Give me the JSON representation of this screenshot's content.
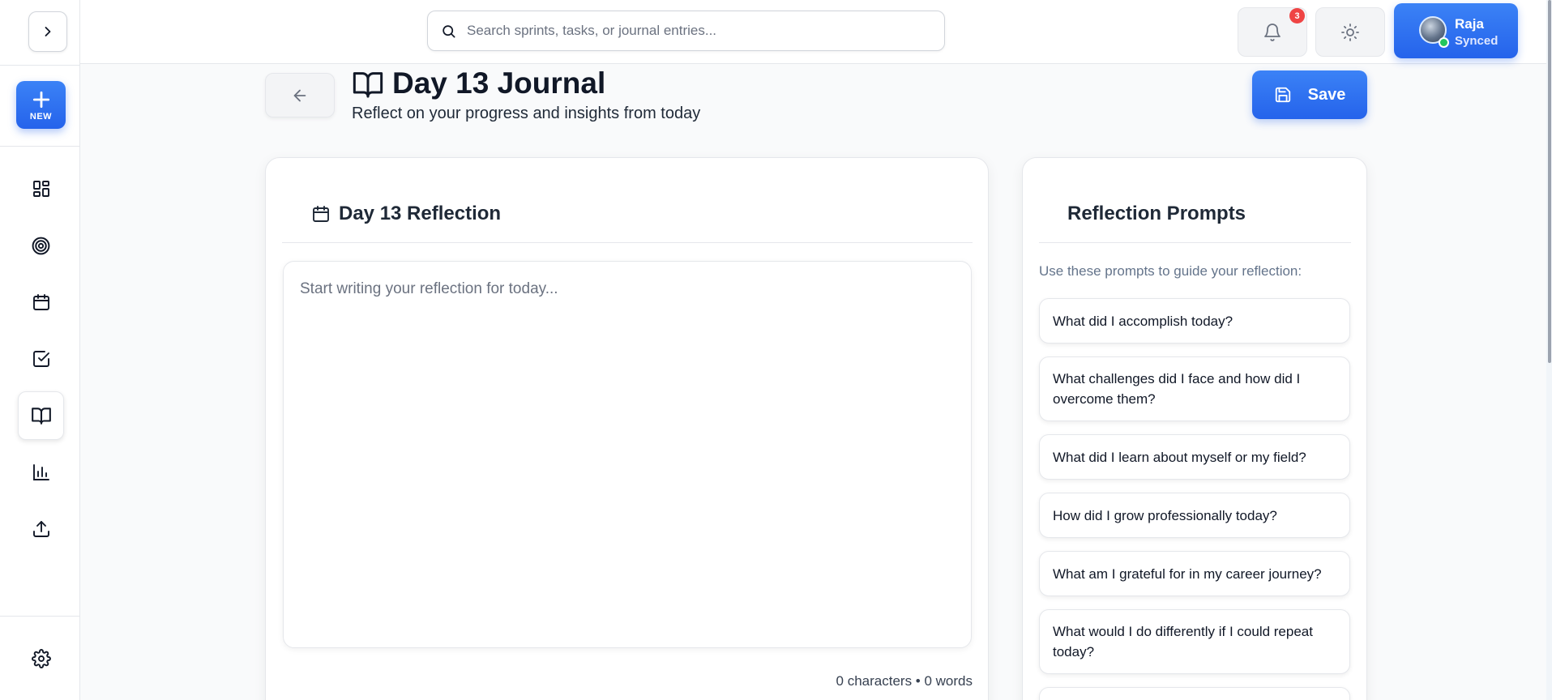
{
  "header": {
    "search_placeholder": "Search sprints, tasks, or journal entries...",
    "notification_count": "3",
    "user": {
      "name": "Raja",
      "status": "Synced"
    }
  },
  "sidebar": {
    "new_label": "NEW",
    "items": [
      {
        "name": "dashboard",
        "icon": "dashboard-icon",
        "active": false
      },
      {
        "name": "goals",
        "icon": "target-icon",
        "active": false
      },
      {
        "name": "calendar",
        "icon": "calendar-icon",
        "active": false
      },
      {
        "name": "tasks",
        "icon": "checkbox-icon",
        "active": false
      },
      {
        "name": "journal",
        "icon": "book-open-icon",
        "active": true
      },
      {
        "name": "analytics",
        "icon": "bar-chart-icon",
        "active": false
      },
      {
        "name": "export",
        "icon": "upload-icon",
        "active": false
      },
      {
        "name": "settings",
        "icon": "gear-icon",
        "active": false
      }
    ]
  },
  "page": {
    "title": "Day 13 Journal",
    "subtitle": "Reflect on your progress and insights from today",
    "save_label": "Save"
  },
  "editor": {
    "title": "Day 13 Reflection",
    "placeholder": "Start writing your reflection for today...",
    "value": "",
    "counter": "0 characters • 0 words"
  },
  "prompts": {
    "title": "Reflection Prompts",
    "hint": "Use these prompts to guide your reflection:",
    "items": [
      "What did I accomplish today?",
      "What challenges did I face and how did I overcome them?",
      "What did I learn about myself or my field?",
      "How did I grow professionally today?",
      "What am I grateful for in my career journey?",
      "What would I do differently if I could repeat today?"
    ]
  },
  "colors": {
    "accent": "#2563eb",
    "badge": "#ef4444",
    "online": "#22c55e"
  }
}
